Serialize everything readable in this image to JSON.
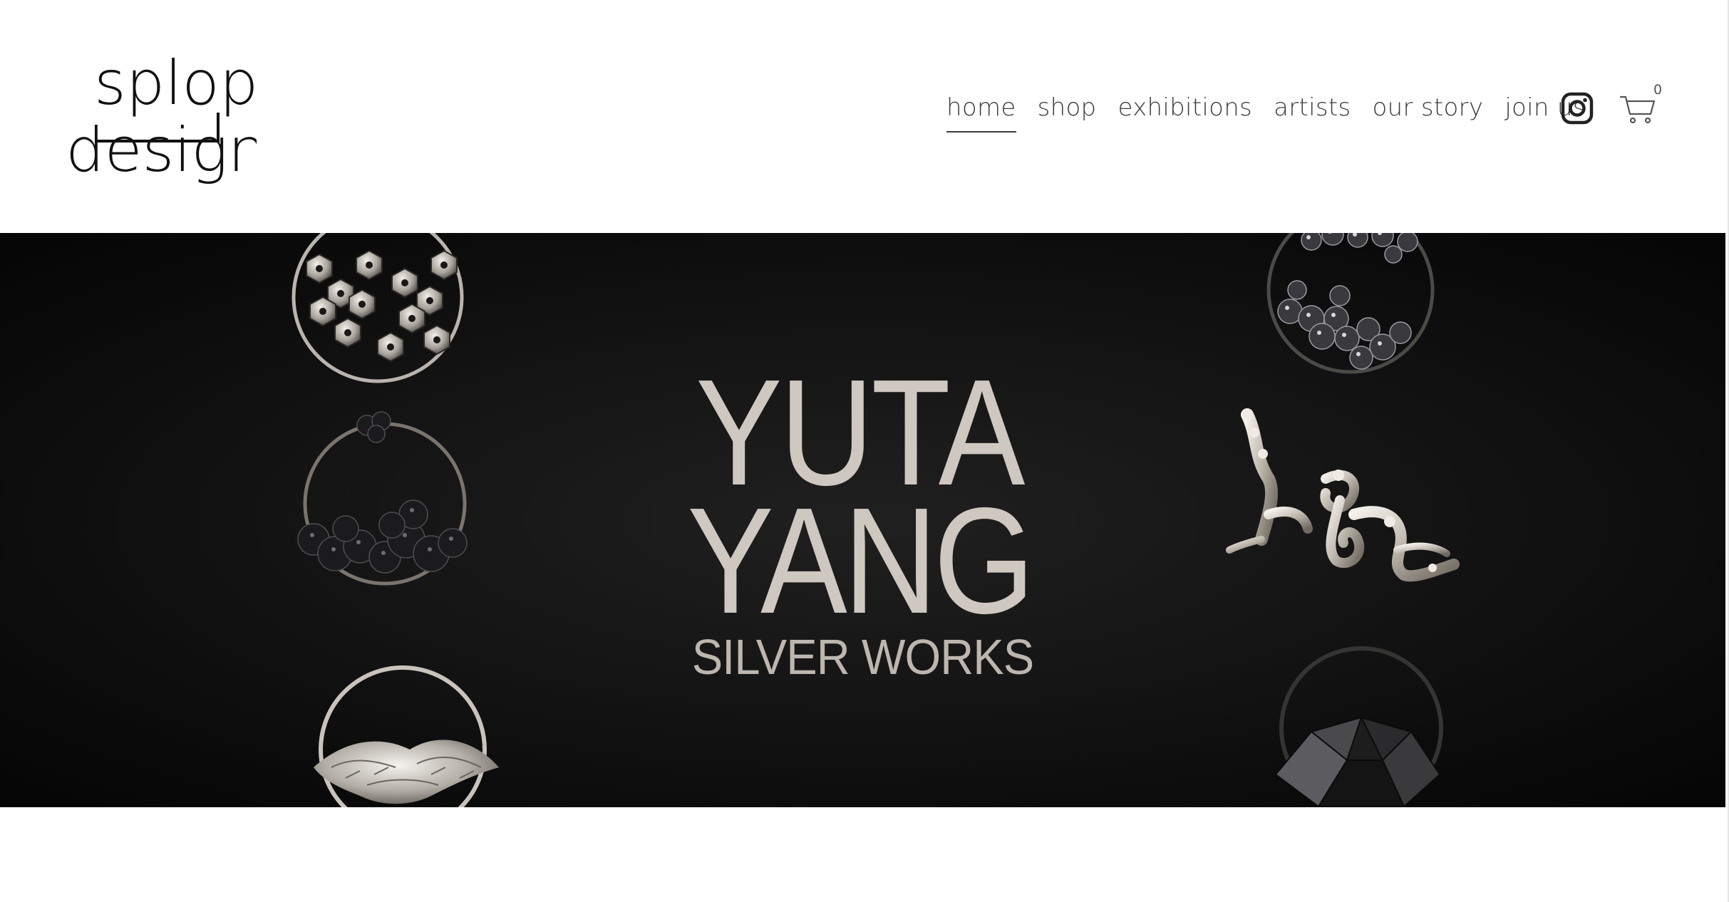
{
  "brand": {
    "logo_line1": "splop",
    "logo_line2": "design"
  },
  "nav": {
    "items": [
      {
        "label": "home",
        "active": true
      },
      {
        "label": "shop",
        "active": false
      },
      {
        "label": "exhibitions",
        "active": false
      },
      {
        "label": "artists",
        "active": false
      },
      {
        "label": "our story",
        "active": false
      },
      {
        "label": "join us",
        "active": false
      }
    ],
    "instagram_icon": "instagram-icon",
    "cart_icon": "cart-icon",
    "cart_count": "0"
  },
  "hero": {
    "title_line1": "YUTA",
    "title_line2": "YANG",
    "subtitle": "SILVER WORKS",
    "background_color": "#0a0a0a",
    "text_color": "#cfc8c0"
  },
  "colors": {
    "nav_text": "#3d3d3d",
    "logo": "#111111",
    "page_background": "#ffffff"
  }
}
